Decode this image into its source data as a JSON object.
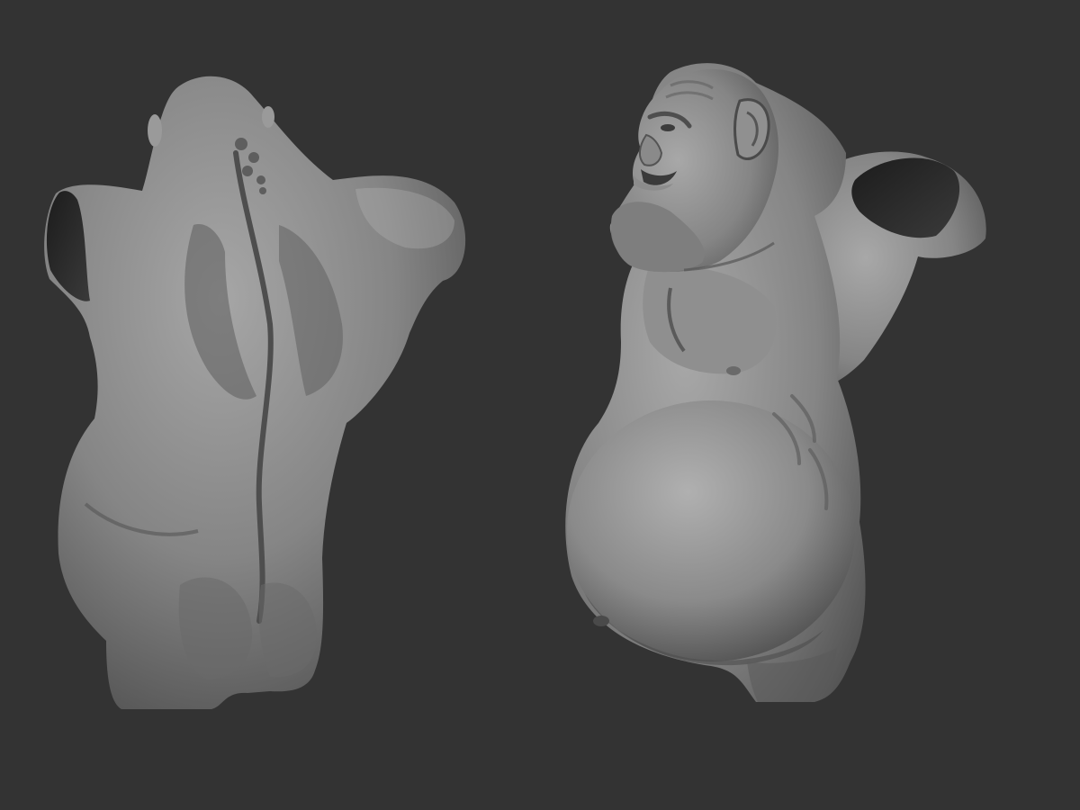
{
  "scene": {
    "background_color": "#333333",
    "clay_light": "#a9a9a9",
    "clay_mid": "#7c7c7c",
    "clay_dark": "#4a4a4a",
    "clay_shadow": "#262626",
    "models": [
      {
        "view": "back"
      },
      {
        "view": "three-quarter-front"
      }
    ]
  }
}
